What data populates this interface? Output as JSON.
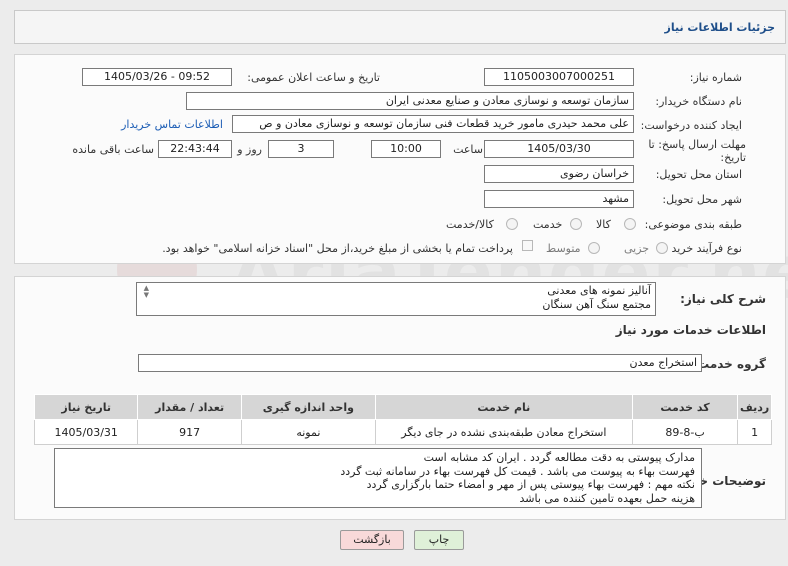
{
  "header": {
    "title": "جزئیات اطلاعات نیاز"
  },
  "form": {
    "need_number": {
      "label": "شماره نیاز:",
      "value": "1105003007000251"
    },
    "announce": {
      "label": "تاریخ و ساعت اعلان عمومی:",
      "value": "1405/03/26 - 09:52"
    },
    "buyer_org": {
      "label": "نام دستگاه خریدار:",
      "value": "سازمان توسعه و نوسازی معادن و صنایع معدنی ایران"
    },
    "creator": {
      "label": "ایجاد کننده درخواست:",
      "value": "علی محمد حیدری مامور خرید قطعات فنی سازمان توسعه و نوسازی معادن و ص",
      "contact_link": "اطلاعات تماس خریدار"
    },
    "deadline": {
      "label": "مهلت ارسال پاسخ: تا تاریخ:",
      "date": "1405/03/30",
      "time_label": "ساعت",
      "time": "10:00",
      "days": "3",
      "days_label": "روز و",
      "remaining": "22:43:44",
      "remaining_label": "ساعت باقی مانده"
    },
    "province": {
      "label": "استان محل تحویل:",
      "value": "خراسان رضوی"
    },
    "city": {
      "label": "شهر محل تحویل:",
      "value": "مشهد"
    },
    "category": {
      "label": "طبقه بندی موضوعی:",
      "options": [
        "کالا",
        "خدمت",
        "کالا/خدمت"
      ]
    },
    "purchase_type": {
      "label": "نوع فرآیند خرید :",
      "options": [
        "جزیی",
        "متوسط"
      ],
      "payment_note": "پرداخت تمام یا بخشی از مبلغ خرید،از محل \"اسناد خزانه اسلامی\" خواهد بود."
    }
  },
  "description": {
    "label": "شرح کلی نیاز:",
    "line1": "آنالیز نمونه های معدنی",
    "line2": "مجتمع سنگ آهن سنگان"
  },
  "services": {
    "section_title": "اطلاعات خدمات مورد نیاز",
    "group_label": "گروه خدمت:",
    "group_value": "استخراج معدن",
    "columns": [
      "ردیف",
      "کد خدمت",
      "نام خدمت",
      "واحد اندازه گیری",
      "تعداد / مقدار",
      "تاریخ نیاز"
    ],
    "rows": [
      [
        "1",
        "ب-8-89",
        "استخراج معادن طبقه‌بندی نشده در جای دیگر",
        "نمونه",
        "917",
        "1405/03/31"
      ]
    ]
  },
  "buyer_notes": {
    "label": "توضیحات خریدار:",
    "lines": [
      "مدارک پیوستی به دقت مطالعه گردد . ایران کد مشابه است",
      "فهرست بهاء به پیوست می باشد . قیمت کل فهرست بهاء در سامانه ثبت گردد",
      "نکته مهم : فهرست بهاء پیوستی پس از مهر و امضاء حتما بارگزاری گردد",
      "هزینه حمل بعهده تامین کننده می باشد"
    ]
  },
  "buttons": {
    "print": "چاپ",
    "back": "بازگشت"
  },
  "watermark": "AriaTender.net",
  "colors": {
    "title": "#1f4f8a",
    "link": "#1c5db5",
    "back_button": "#f8d9d9",
    "print_button": "#dff0d8"
  }
}
